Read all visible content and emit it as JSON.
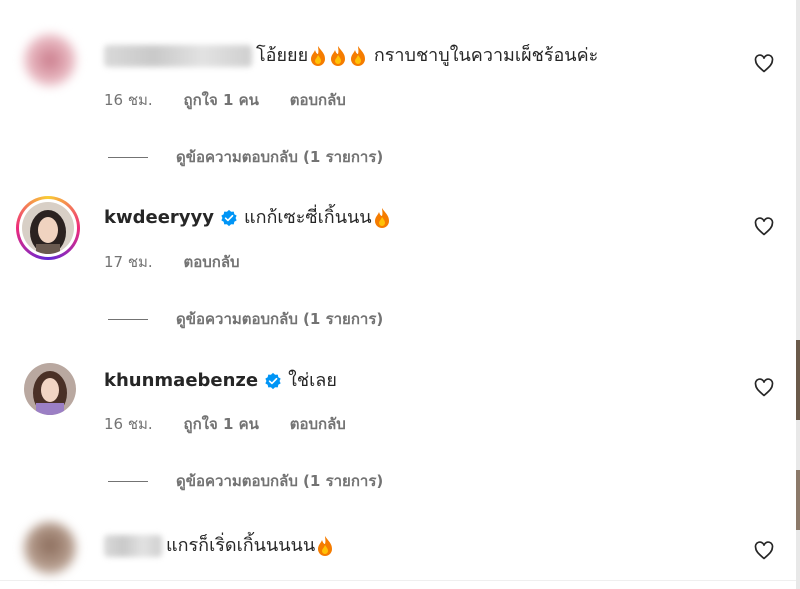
{
  "comments": [
    {
      "username": "",
      "text": "โอ้ยยย🔥🔥🔥 กราบชาบูในความเผ็ชร้อนค่ะ",
      "time": "16 ชม.",
      "likes": "ถูกใจ 1 คน",
      "reply": "ตอบกลับ",
      "view_replies": "ดูข้อความตอบกลับ (1 รายการ)"
    },
    {
      "username": "kwdeeryyy",
      "text": "แกก้เซะซี่เกิ้นนน",
      "time": "17 ชม.",
      "likes": "",
      "reply": "ตอบกลับ",
      "view_replies": "ดูข้อความตอบกลับ (1 รายการ)"
    },
    {
      "username": "khunmaebenze",
      "text": "ใช่เลย",
      "time": "16 ชม.",
      "likes": "ถูกใจ 1 คน",
      "reply": "ตอบกลับ",
      "view_replies": "ดูข้อความตอบกลับ (1 รายการ)"
    },
    {
      "username": "",
      "text": "แกรก็เริ่ดเกิ้นนนนน",
      "time": "",
      "likes": "",
      "reply": "",
      "view_replies": ""
    }
  ],
  "colors": {
    "text": "#262626",
    "muted": "#737373",
    "verified": "#0095f6",
    "fire": "#f57c00"
  },
  "icons": [
    "heart-icon",
    "verified-badge-icon",
    "fire-emoji-icon"
  ]
}
